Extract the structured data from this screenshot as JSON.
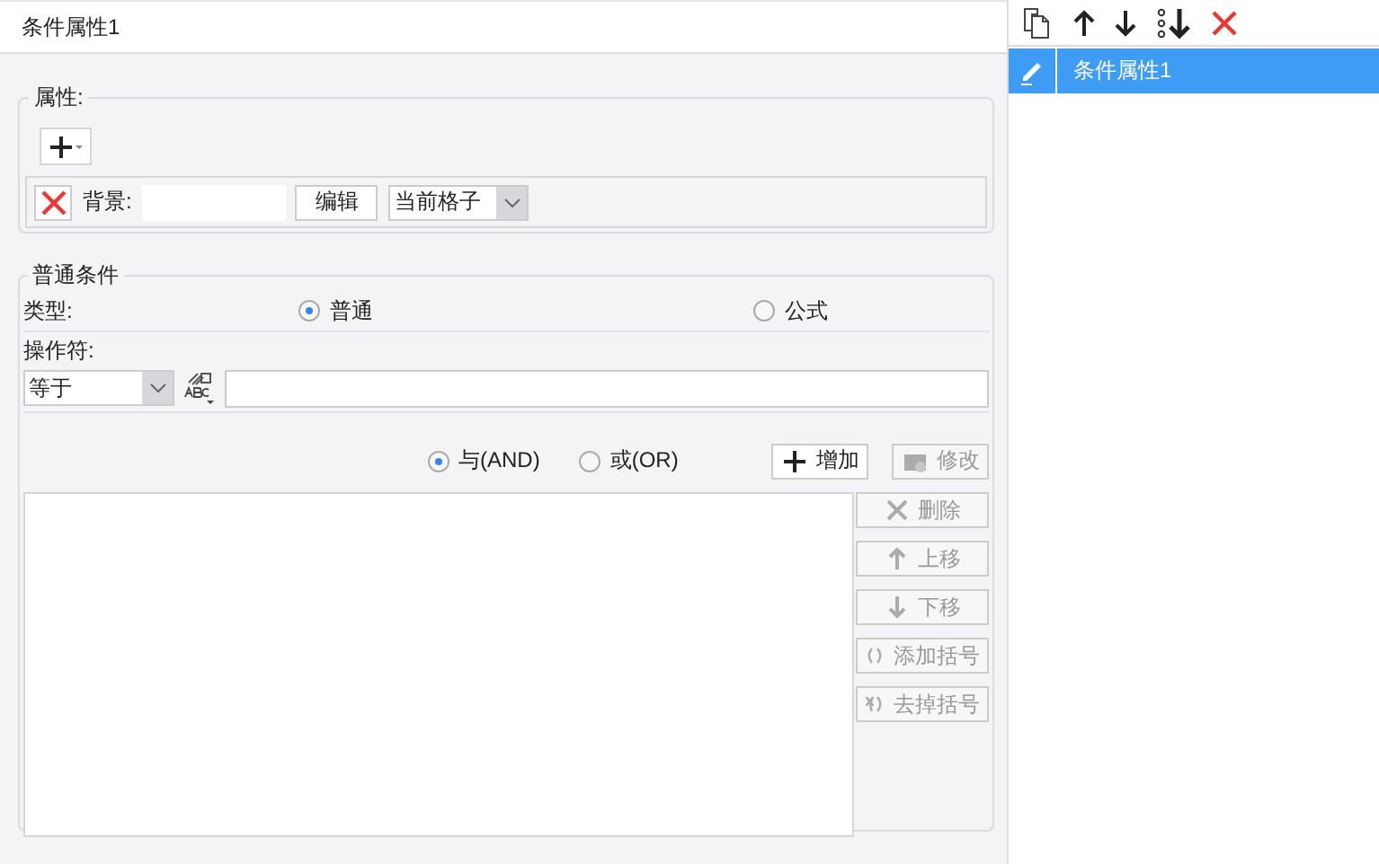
{
  "panel": {
    "title": "条件属性1"
  },
  "attributes": {
    "legend": "属性:",
    "rows": [
      {
        "label": "背景:",
        "edit_button": "编辑",
        "scope": "当前格子"
      }
    ]
  },
  "condition": {
    "legend": "普通条件",
    "type_label": "类型:",
    "types": [
      {
        "label": "普通",
        "selected": true
      },
      {
        "label": "公式",
        "selected": false
      }
    ],
    "operator_label": "操作符:",
    "operator": "等于",
    "logic": [
      {
        "label": "与(AND)",
        "selected": true
      },
      {
        "label": "或(OR)",
        "selected": false
      }
    ],
    "buttons": [
      {
        "label": "增加",
        "kind": "plus",
        "disabled": false
      },
      {
        "label": "修改",
        "kind": "edit",
        "disabled": true
      }
    ],
    "side_buttons": [
      {
        "label": "删除",
        "kind": "delete",
        "disabled": true
      },
      {
        "label": "上移",
        "kind": "up",
        "disabled": true
      },
      {
        "label": "下移",
        "kind": "down",
        "disabled": true
      },
      {
        "label": "添加括号",
        "kind": "paren",
        "disabled": true
      },
      {
        "label": "去掉括号",
        "kind": "unparen",
        "disabled": true
      }
    ]
  },
  "list": {
    "items": [
      {
        "label": "条件属性1",
        "selected": true
      }
    ]
  }
}
